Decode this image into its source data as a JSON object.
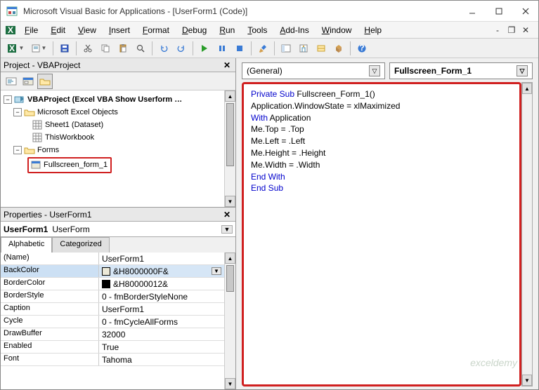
{
  "window": {
    "title": "Microsoft Visual Basic for Applications - [UserForm1 (Code)]"
  },
  "menu": {
    "items": [
      "File",
      "Edit",
      "View",
      "Insert",
      "Format",
      "Debug",
      "Run",
      "Tools",
      "Add-Ins",
      "Window",
      "Help"
    ]
  },
  "project_panel": {
    "title": "Project - VBAProject",
    "root": "VBAProject (Excel VBA Show Userform …",
    "folder_excel": "Microsoft Excel Objects",
    "sheet1": "Sheet1 (Dataset)",
    "workbook": "ThisWorkbook",
    "folder_forms": "Forms",
    "form1": "Fullscreen_form_1"
  },
  "props_panel": {
    "title": "Properties - UserForm1",
    "object_name": "UserForm1",
    "object_type": "UserForm",
    "tab_alpha": "Alphabetic",
    "tab_cat": "Categorized",
    "rows": [
      {
        "name": "(Name)",
        "val": "UserForm1"
      },
      {
        "name": "BackColor",
        "val": "&H8000000F&",
        "swatch": "#ece9d8"
      },
      {
        "name": "BorderColor",
        "val": "&H80000012&",
        "swatch": "#000000"
      },
      {
        "name": "BorderStyle",
        "val": "0 - fmBorderStyleNone"
      },
      {
        "name": "Caption",
        "val": "UserForm1"
      },
      {
        "name": "Cycle",
        "val": "0 - fmCycleAllForms"
      },
      {
        "name": "DrawBuffer",
        "val": "32000"
      },
      {
        "name": "Enabled",
        "val": "True"
      },
      {
        "name": "Font",
        "val": "Tahoma"
      }
    ]
  },
  "code_pane": {
    "object_combo": "(General)",
    "proc_combo": "Fullscreen_Form_1",
    "lines": [
      [
        {
          "t": "Private Sub ",
          "kw": true
        },
        {
          "t": "Fullscreen_Form_1()"
        }
      ],
      [
        {
          "t": "Application.WindowState = xlMaximized"
        }
      ],
      [
        {
          "t": "With ",
          "kw": true
        },
        {
          "t": "Application"
        }
      ],
      [
        {
          "t": "Me.Top = .Top"
        }
      ],
      [
        {
          "t": "Me.Left = .Left"
        }
      ],
      [
        {
          "t": "Me.Height = .Height"
        }
      ],
      [
        {
          "t": "Me.Width = .Width"
        }
      ],
      [
        {
          "t": "End With",
          "kw": true
        }
      ],
      [
        {
          "t": "End Sub",
          "kw": true
        }
      ]
    ]
  },
  "watermark": "exceldemy"
}
